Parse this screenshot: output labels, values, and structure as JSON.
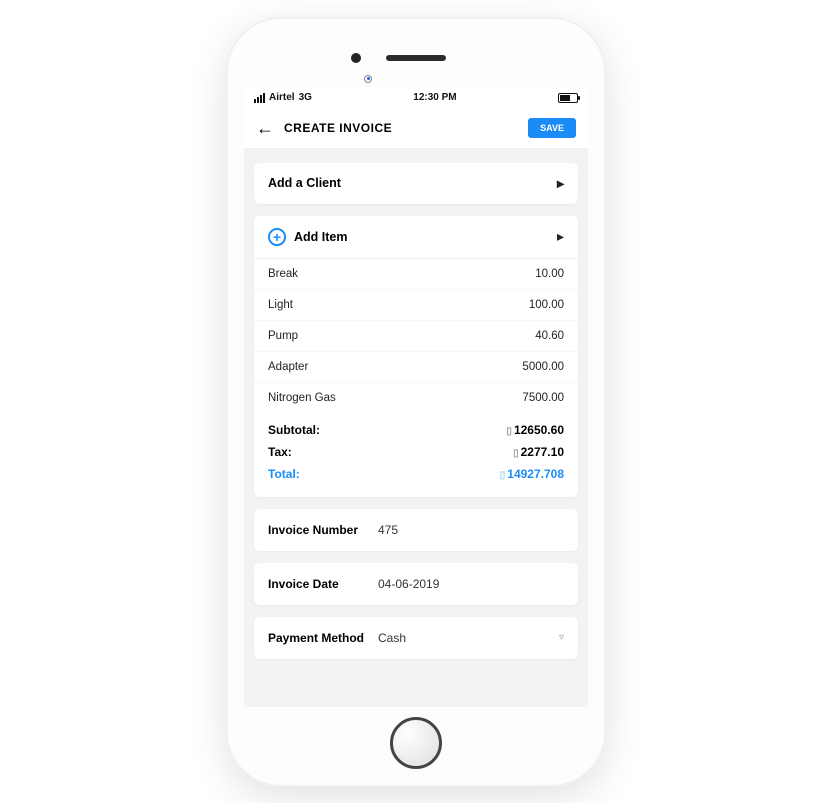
{
  "status": {
    "carrier": "Airtel",
    "network": "3G",
    "time": "12:30 PM"
  },
  "header": {
    "title": "CREATE INVOICE",
    "save_label": "SAVE"
  },
  "client": {
    "add_label": "Add a Client"
  },
  "items_section": {
    "add_label": "Add Item",
    "items": [
      {
        "name": "Break",
        "price": "10.00"
      },
      {
        "name": "Light",
        "price": "100.00"
      },
      {
        "name": "Pump",
        "price": "40.60"
      },
      {
        "name": "Adapter",
        "price": "5000.00"
      },
      {
        "name": "Nitrogen Gas",
        "price": "7500.00"
      }
    ],
    "subtotal_label": "Subtotal:",
    "subtotal_value": "12650.60",
    "tax_label": "Tax:",
    "tax_value": "2277.10",
    "total_label": "Total:",
    "total_value": "14927.708"
  },
  "invoice_number": {
    "label": "Invoice Number",
    "value": "475"
  },
  "invoice_date": {
    "label": "Invoice Date",
    "value": "04-06-2019"
  },
  "payment_method": {
    "label": "Payment Method",
    "value": "Cash"
  }
}
